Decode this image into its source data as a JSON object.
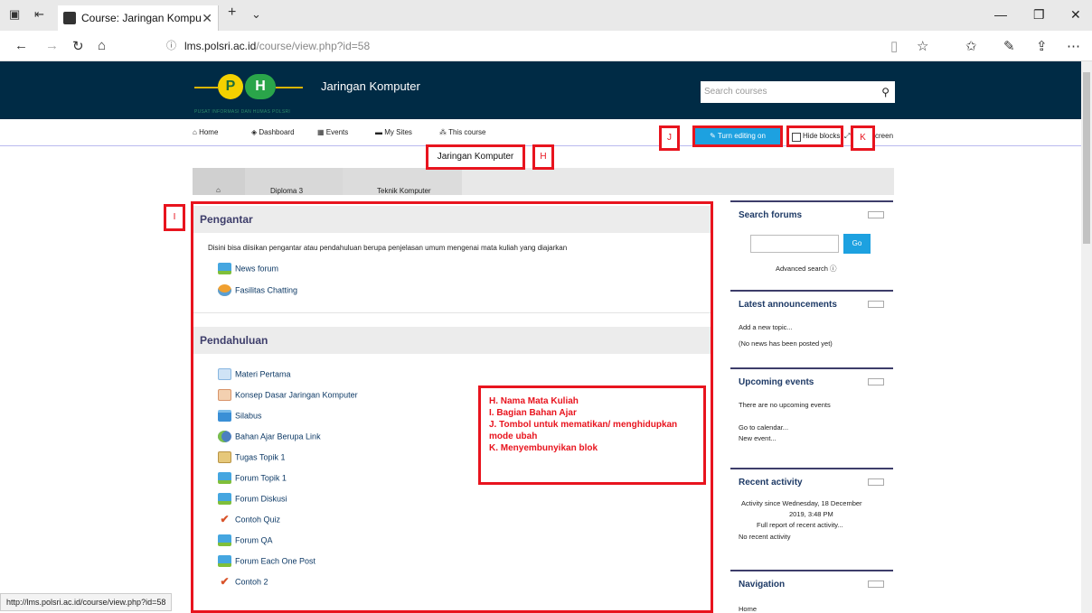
{
  "browser": {
    "tab_title": "Course: Jaringan Kompu",
    "tab_close": "✕",
    "new_tab": "+",
    "tab_menu": "⌄",
    "url_host": "lms.polsri.ac.id",
    "url_path": "/course/view.php?id=58",
    "status_url": "http://lms.polsri.ac.id/course/view.php?id=58",
    "win_min": "—",
    "win_max": "❐",
    "win_close": "✕"
  },
  "site": {
    "logo_p": "P",
    "logo_h": "H",
    "logo_sub": "PUSAT INFORMASI DAN HUMAS POLSRI",
    "name": "Jaringan Komputer",
    "search_placeholder": "Search courses"
  },
  "nav": {
    "home": "Home",
    "dashboard": "Dashboard",
    "events": "Events",
    "mysites": "My Sites",
    "thiscourse": "This course",
    "turn_editing": "Turn editing on",
    "hide_blocks": "Hide blocks",
    "fullscreen_partial": "creen"
  },
  "course_title": "Jaringan Komputer",
  "breadcrumb": [
    "Diploma 3",
    "Teknik Komputer"
  ],
  "sections": [
    {
      "title": "Pengantar",
      "summary": "Disini bisa diisikan pengantar atau pendahuluan berupa penjelasan umum mengenai mata kuliah yang diajarkan",
      "activities": [
        {
          "label": "News forum",
          "icon": "forum-icon"
        },
        {
          "label": "Fasilitas Chatting",
          "icon": "chat-icon"
        }
      ]
    },
    {
      "title": "Pendahuluan",
      "activities": [
        {
          "label": "Materi Pertama",
          "icon": "page-icon"
        },
        {
          "label": "Konsep Dasar Jaringan Komputer",
          "icon": "book-icon"
        },
        {
          "label": "Silabus",
          "icon": "folder-icon"
        },
        {
          "label": "Bahan Ajar Berupa Link",
          "icon": "url-icon"
        },
        {
          "label": "Tugas Topik 1",
          "icon": "assignment-icon"
        },
        {
          "label": "Forum Topik 1",
          "icon": "forum-icon"
        },
        {
          "label": "Forum Diskusi",
          "icon": "forum-icon"
        },
        {
          "label": "Contoh Quiz",
          "icon": "quiz-icon"
        },
        {
          "label": "Forum QA",
          "icon": "forum-icon"
        },
        {
          "label": "Forum Each One Post",
          "icon": "forum-icon"
        },
        {
          "label": "Contoh 2",
          "icon": "quiz-icon"
        }
      ]
    }
  ],
  "blocks": {
    "search_forums": {
      "title": "Search forums",
      "go": "Go",
      "advanced": "Advanced search"
    },
    "latest_announcements": {
      "title": "Latest announcements",
      "add": "Add a new topic...",
      "none": "(No news has been posted yet)"
    },
    "upcoming_events": {
      "title": "Upcoming events",
      "none": "There are no upcoming events",
      "calendar": "Go to calendar...",
      "new_event": "New event..."
    },
    "recent_activity": {
      "title": "Recent activity",
      "since_1": "Activity since Wednesday, 18 December",
      "since_2": "2019, 3:48 PM",
      "full_report": "Full report of recent activity...",
      "none": "No recent activity"
    },
    "navigation": {
      "title": "Navigation",
      "home": "Home"
    }
  },
  "annotations": {
    "h": "H",
    "i": "I",
    "j": "J",
    "k": "K",
    "legend": [
      "H. Nama Mata Kuliah",
      "I. Bagian Bahan Ajar",
      "J. Tombol untuk mematikan/ menghidupkan",
      "mode ubah",
      "K. Menyembunyikan blok"
    ]
  },
  "colors": {
    "header_bg": "#002b45",
    "accent": "#1da1e0",
    "annotation": "#e8141e"
  }
}
